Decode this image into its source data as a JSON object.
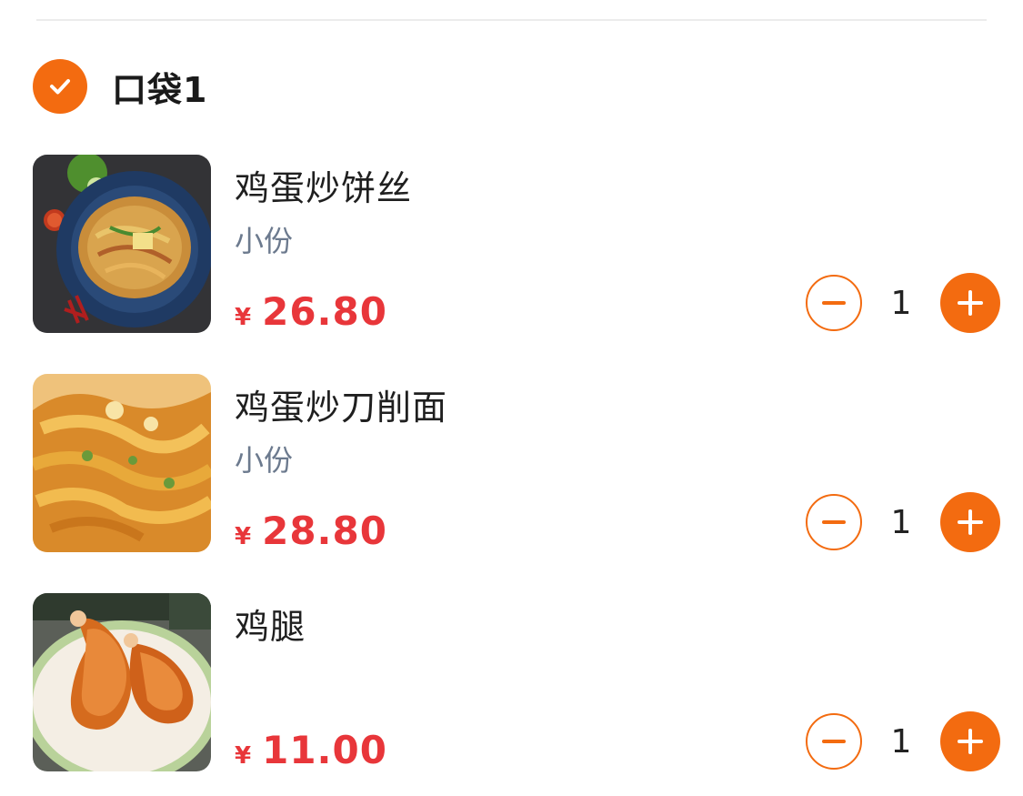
{
  "bag": {
    "title": "口袋1",
    "selected": true
  },
  "items": [
    {
      "name": "鸡蛋炒饼丝",
      "spec": "小份",
      "currency": "¥",
      "price": "26.80",
      "quantity": "1",
      "image": "fried-shredded-pancake-photo"
    },
    {
      "name": "鸡蛋炒刀削面",
      "spec": "小份",
      "currency": "¥",
      "price": "28.80",
      "quantity": "1",
      "image": "fried-knife-cut-noodles-photo"
    },
    {
      "name": "鸡腿",
      "spec": "",
      "currency": "¥",
      "price": "11.00",
      "quantity": "1",
      "image": "chicken-drumstick-photo"
    }
  ],
  "icons": {
    "check": "check-icon",
    "minus": "minus-icon",
    "plus": "plus-icon"
  },
  "colors": {
    "accent": "#f36b10",
    "price": "#e8363a",
    "spec": "#6c7a8e"
  }
}
